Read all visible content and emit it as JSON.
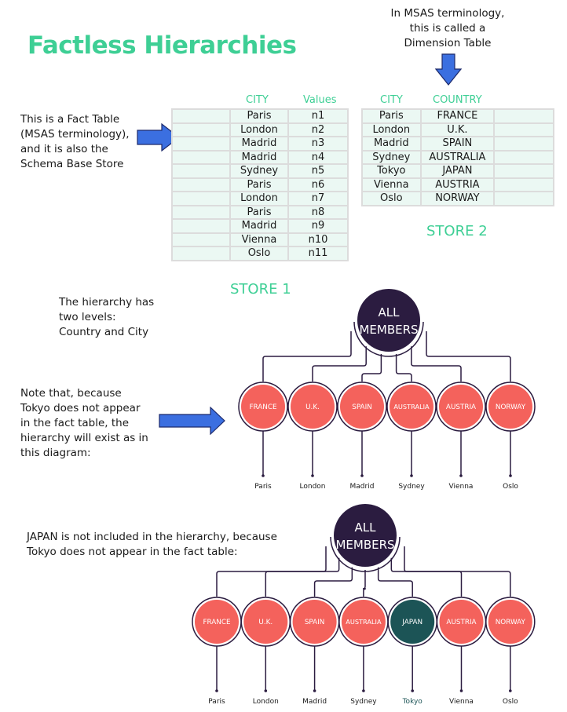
{
  "title": "Factless Hierarchies",
  "colors": {
    "accent_green": "#3ecf95",
    "arrow_blue": "#3b6fe0",
    "root_node": "#2b1c40",
    "country_node": "#f4625c",
    "excluded_node": "#1c5456",
    "table_fill": "#ebf8f3"
  },
  "notes": {
    "dimension_note": [
      "In MSAS terminology,",
      "this is called a",
      "Dimension Table"
    ],
    "fact_note": [
      "This is a Fact Table",
      "(MSAS terminology),",
      "and it is also the",
      "Schema Base Store"
    ],
    "levels_note": [
      "The hierarchy has",
      "two levels:",
      "Country and City"
    ],
    "tokyo_note": [
      "Note that, because",
      "Tokyo does not appear",
      "in the fact table, the",
      "hierarchy will exist as in",
      "this diagram:"
    ],
    "japan_note": [
      "JAPAN is not included in the hierarchy, because",
      "Tokyo does not appear in the fact table:"
    ]
  },
  "store1": {
    "label": "STORE 1",
    "headers": [
      "CITY",
      "Values"
    ],
    "rows": [
      [
        "Paris",
        "n1"
      ],
      [
        "London",
        "n2"
      ],
      [
        "Madrid",
        "n3"
      ],
      [
        "Madrid",
        "n4"
      ],
      [
        "Sydney",
        "n5"
      ],
      [
        "Paris",
        "n6"
      ],
      [
        "London",
        "n7"
      ],
      [
        "Paris",
        "n8"
      ],
      [
        "Madrid",
        "n9"
      ],
      [
        "Vienna",
        "n10"
      ],
      [
        "Oslo",
        "n11"
      ]
    ]
  },
  "store2": {
    "label": "STORE 2",
    "headers": [
      "CITY",
      "COUNTRY"
    ],
    "rows": [
      [
        "Paris",
        "FRANCE"
      ],
      [
        "London",
        "U.K."
      ],
      [
        "Madrid",
        "SPAIN"
      ],
      [
        "Sydney",
        "AUSTRALIA"
      ],
      [
        "Tokyo",
        "JAPAN"
      ],
      [
        "Vienna",
        "AUSTRIA"
      ],
      [
        "Oslo",
        "NORWAY"
      ]
    ]
  },
  "hierarchy1": {
    "root": [
      "ALL",
      "MEMBERS"
    ],
    "members": [
      {
        "country": "FRANCE",
        "city": "Paris",
        "excluded": false
      },
      {
        "country": "U.K.",
        "city": "London",
        "excluded": false
      },
      {
        "country": "SPAIN",
        "city": "Madrid",
        "excluded": false
      },
      {
        "country": "AUSTRALIA",
        "city": "Sydney",
        "excluded": false
      },
      {
        "country": "AUSTRIA",
        "city": "Vienna",
        "excluded": false
      },
      {
        "country": "NORWAY",
        "city": "Oslo",
        "excluded": false
      }
    ]
  },
  "hierarchy2": {
    "root": [
      "ALL",
      "MEMBERS"
    ],
    "members": [
      {
        "country": "FRANCE",
        "city": "Paris",
        "excluded": false
      },
      {
        "country": "U.K.",
        "city": "London",
        "excluded": false
      },
      {
        "country": "SPAIN",
        "city": "Madrid",
        "excluded": false
      },
      {
        "country": "AUSTRALIA",
        "city": "Sydney",
        "excluded": false
      },
      {
        "country": "JAPAN",
        "city": "Tokyo",
        "excluded": true
      },
      {
        "country": "AUSTRIA",
        "city": "Vienna",
        "excluded": false
      },
      {
        "country": "NORWAY",
        "city": "Oslo",
        "excluded": false
      }
    ]
  }
}
